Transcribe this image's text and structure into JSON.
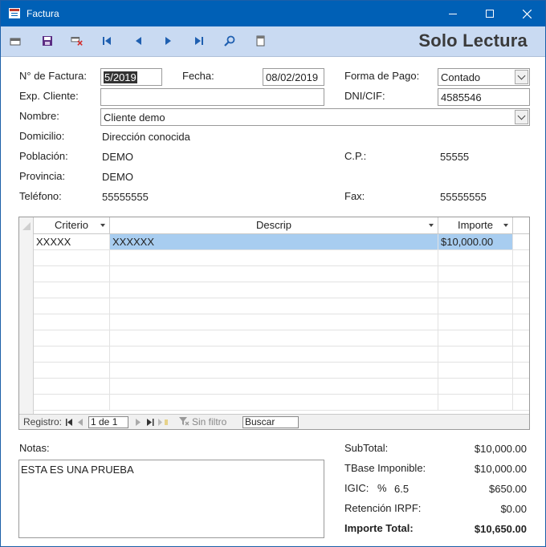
{
  "window": {
    "title": "Factura"
  },
  "toolbar": {
    "mode_label": "Solo Lectura"
  },
  "form": {
    "invoice_number_label": "N° de Factura:",
    "invoice_number_value": "5/2019",
    "date_label": "Fecha:",
    "date_value": "08/02/2019",
    "payment_label": "Forma de Pago:",
    "payment_value": "Contado",
    "client_file_label": "Exp. Cliente:",
    "client_file_value": "",
    "tax_id_label": "DNI/CIF:",
    "tax_id_value": "4585546",
    "name_label": "Nombre:",
    "name_value": "Cliente demo",
    "address_label": "Domicilio:",
    "address_value": "Dirección conocida",
    "city_label": "Población:",
    "city_value": "DEMO",
    "postal_label": "C.P.:",
    "postal_value": "55555",
    "province_label": "Provincia:",
    "province_value": "DEMO",
    "phone_label": "Teléfono:",
    "phone_value": "55555555",
    "fax_label": "Fax:",
    "fax_value": "55555555"
  },
  "grid": {
    "columns": [
      "Criterio",
      "Descrip",
      "Importe"
    ],
    "rows": [
      {
        "criterio": "XXXXX",
        "descrip": "XXXXXX",
        "importe": "$10,000.00"
      }
    ],
    "nav": {
      "record_label": "Registro:",
      "record_value": "1 de 1",
      "filter_label": "Sin filtro",
      "search_label": "Buscar"
    }
  },
  "notes": {
    "label": "Notas:",
    "value": "ESTA ES UNA PRUEBA"
  },
  "totals": {
    "subtotal_label": "SubTotal:",
    "subtotal_value": "$10,000.00",
    "base_label": "TBase Imponible:",
    "base_value": "$10,000.00",
    "igic_label": "IGIC:",
    "igic_pct_symbol": "%",
    "igic_rate": "6.5",
    "igic_value": "$650.00",
    "irpf_label": "Retención IRPF:",
    "irpf_value": "$0.00",
    "total_label": "Importe Total:",
    "total_value": "$10,650.00"
  },
  "colors": {
    "titlebar": "#0060b6",
    "toolbar": "#c9daf2",
    "selected_row": "#a8cdf0",
    "nav_icons": "#1f5fb0"
  }
}
